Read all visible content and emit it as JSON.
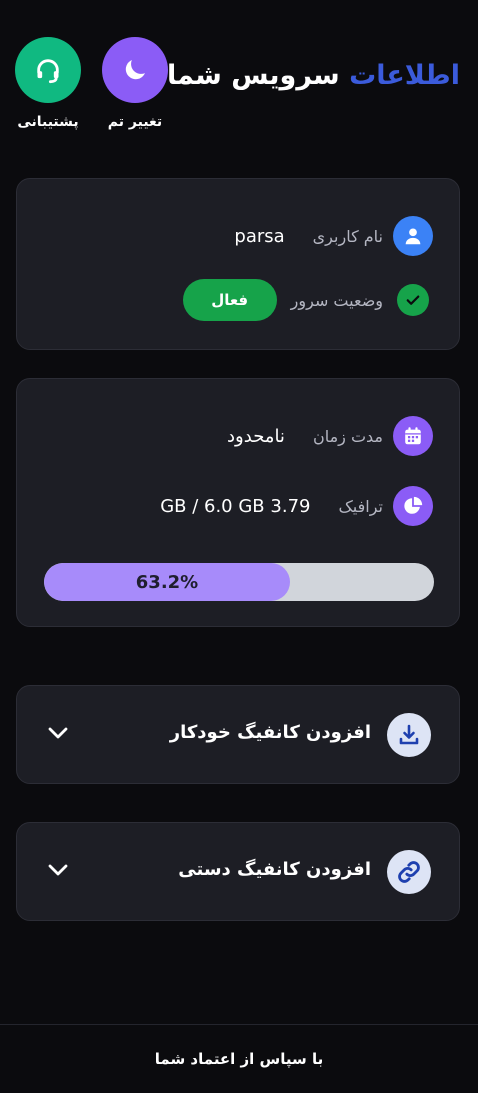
{
  "header": {
    "title_accent": "اطلاعات",
    "title_rest": "سرویس شما",
    "support_label": "پشتیبانی",
    "theme_label": "تغییر تم"
  },
  "account": {
    "username_label": "نام کاربری",
    "username_value": "parsa",
    "server_status_label": "وضعیت سرور",
    "server_status_value": "فعال"
  },
  "usage": {
    "duration_label": "مدت زمان",
    "duration_value": "نامحدود",
    "traffic_label": "ترافیک",
    "traffic_value": "3.79 GB / 6.0 GB",
    "progress_text": "63.2%",
    "progress_fraction": 0.632
  },
  "sections": {
    "auto_config_title": "افزودن کانفیگ خودکار",
    "manual_config_title": "افزودن کانفیگ دستی"
  },
  "footer": {
    "text": "با سپاس از اعتماد شما"
  },
  "colors": {
    "background": "#0b0b0e",
    "card": "#1d1e25",
    "accent_blue": "#3b5bdb",
    "support_green": "#10b981",
    "theme_purple": "#8b5cf6",
    "status_green": "#16a34a",
    "progress_fill": "#a78bfa",
    "progress_track": "#d1d5db"
  },
  "icons": {
    "support": "headset-icon",
    "theme": "moon-icon",
    "username": "user-icon",
    "status": "check-icon",
    "duration": "calendar-icon",
    "traffic": "pie-chart-icon",
    "auto_config": "download-icon",
    "manual_config": "link-icon",
    "expand": "chevron-down-icon"
  }
}
